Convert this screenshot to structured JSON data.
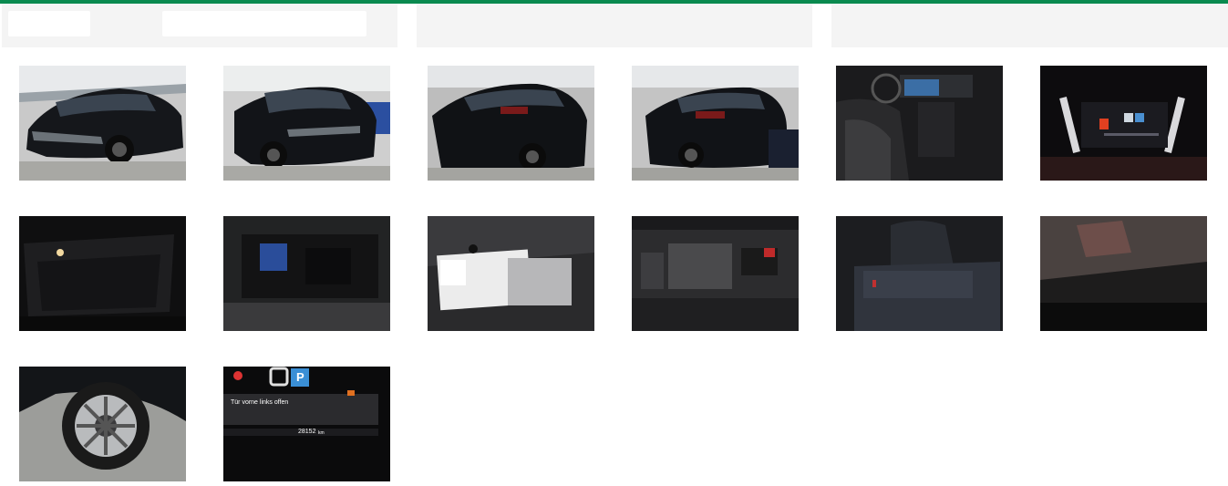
{
  "colors": {
    "accent": "#0a8a4f",
    "panel_bg": "#f4f4f4"
  },
  "gallery": {
    "photos": [
      {
        "subject": "front-three-quarter-left"
      },
      {
        "subject": "front-three-quarter-right"
      },
      {
        "subject": "rear-three-quarter-left"
      },
      {
        "subject": "rear-three-quarter-right"
      },
      {
        "subject": "interior-dashboard"
      },
      {
        "subject": "instrument-cluster"
      },
      {
        "subject": "trunk-open"
      },
      {
        "subject": "under-floor-storage"
      },
      {
        "subject": "manuals-and-key"
      },
      {
        "subject": "engine-bay"
      },
      {
        "subject": "rear-seats"
      },
      {
        "subject": "windshield-reflection"
      },
      {
        "subject": "wheel-closeup"
      },
      {
        "subject": "odometer-display"
      }
    ],
    "odometer_message": "Tür vorne links offen",
    "odometer_reading": "28152",
    "odometer_unit": "km",
    "gear_indicator": "P"
  }
}
